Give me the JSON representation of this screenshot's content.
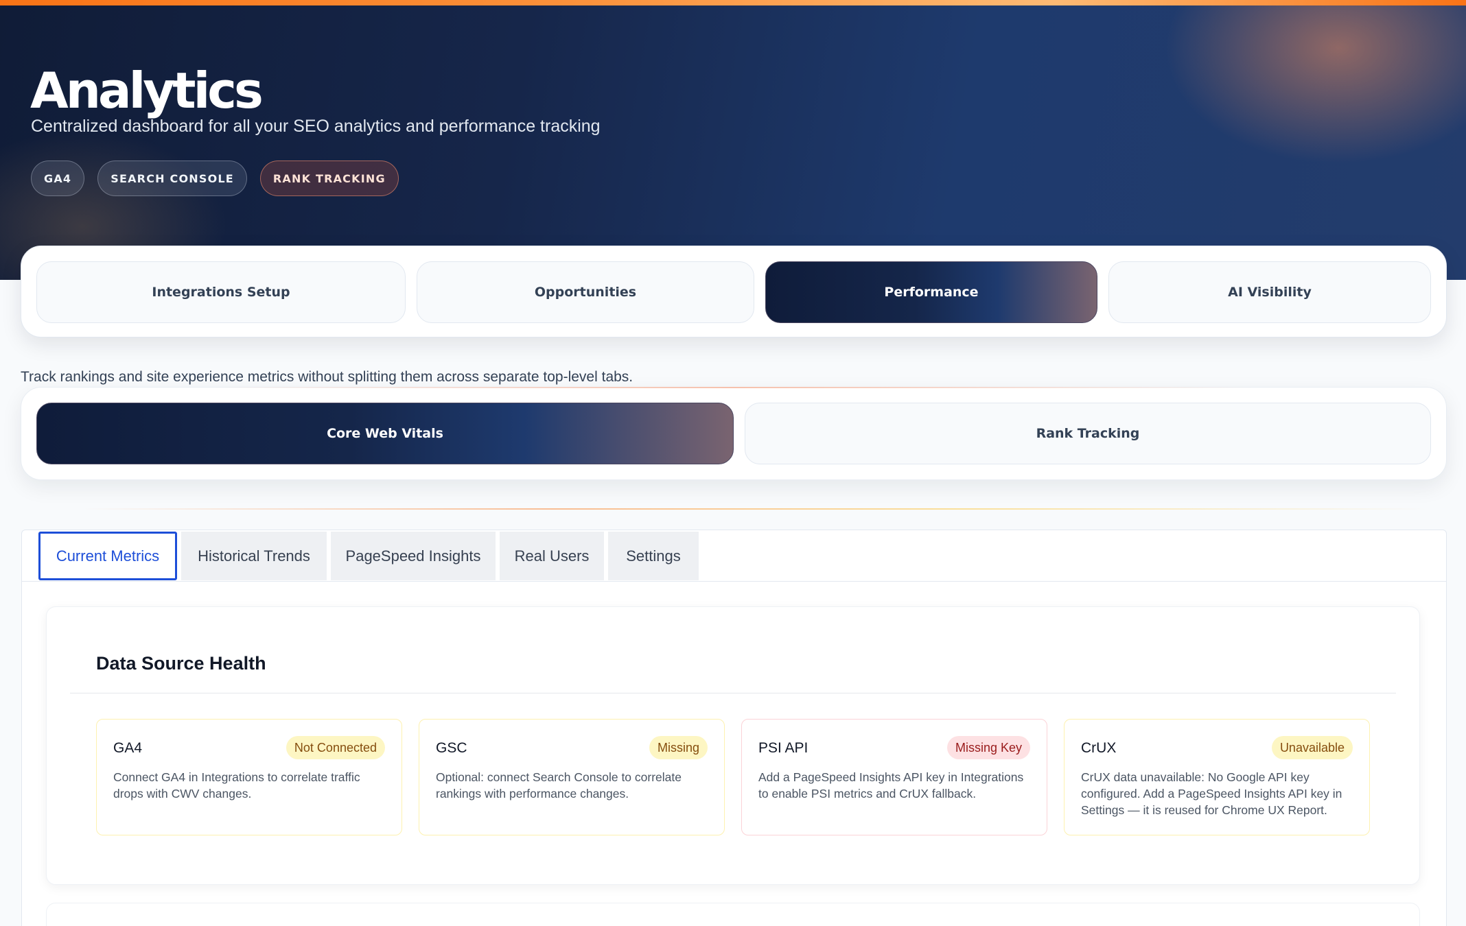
{
  "hero": {
    "title": "Analytics",
    "subtitle": "Centralized dashboard for all your SEO analytics and performance tracking",
    "chips": [
      "GA4",
      "SEARCH CONSOLE",
      "RANK TRACKING"
    ]
  },
  "main_tabs": [
    {
      "label": "Integrations Setup",
      "active": false
    },
    {
      "label": "Opportunities",
      "active": false
    },
    {
      "label": "Performance",
      "active": true
    },
    {
      "label": "AI Visibility",
      "active": false
    }
  ],
  "performance": {
    "description": "Track rankings and site experience metrics without splitting them across separate top-level tabs.",
    "sub_tabs": [
      {
        "label": "Core Web Vitals",
        "active": true
      },
      {
        "label": "Rank Tracking",
        "active": false
      }
    ]
  },
  "metrics_tabs": [
    {
      "label": "Current Metrics",
      "active": true
    },
    {
      "label": "Historical Trends",
      "active": false
    },
    {
      "label": "PageSpeed Insights",
      "active": false
    },
    {
      "label": "Real Users",
      "active": false
    },
    {
      "label": "Settings",
      "active": false
    }
  ],
  "data_source_health": {
    "title": "Data Source Health",
    "sources": [
      {
        "name": "GA4",
        "status": "Not Connected",
        "status_color": "yellow",
        "description": "Connect GA4 in Integrations to correlate traffic drops with CWV changes."
      },
      {
        "name": "GSC",
        "status": "Missing",
        "status_color": "yellow",
        "description": "Optional: connect Search Console to correlate rankings with performance changes."
      },
      {
        "name": "PSI API",
        "status": "Missing Key",
        "status_color": "red",
        "description": "Add a PageSpeed Insights API key in Integrations to enable PSI metrics and CrUX fallback."
      },
      {
        "name": "CrUX",
        "status": "Unavailable",
        "status_color": "yellow",
        "description": "CrUX data unavailable: No Google API key configured. Add a PageSpeed Insights API key in Settings — it is reused for Chrome UX Report."
      }
    ]
  },
  "colors": {
    "accent_orange": "#f97316",
    "hero_navy": "#16264a",
    "active_tab_blue": "#1d4ed8",
    "warning_yellow": "#fdf6c3",
    "error_red": "#fde1e3"
  }
}
